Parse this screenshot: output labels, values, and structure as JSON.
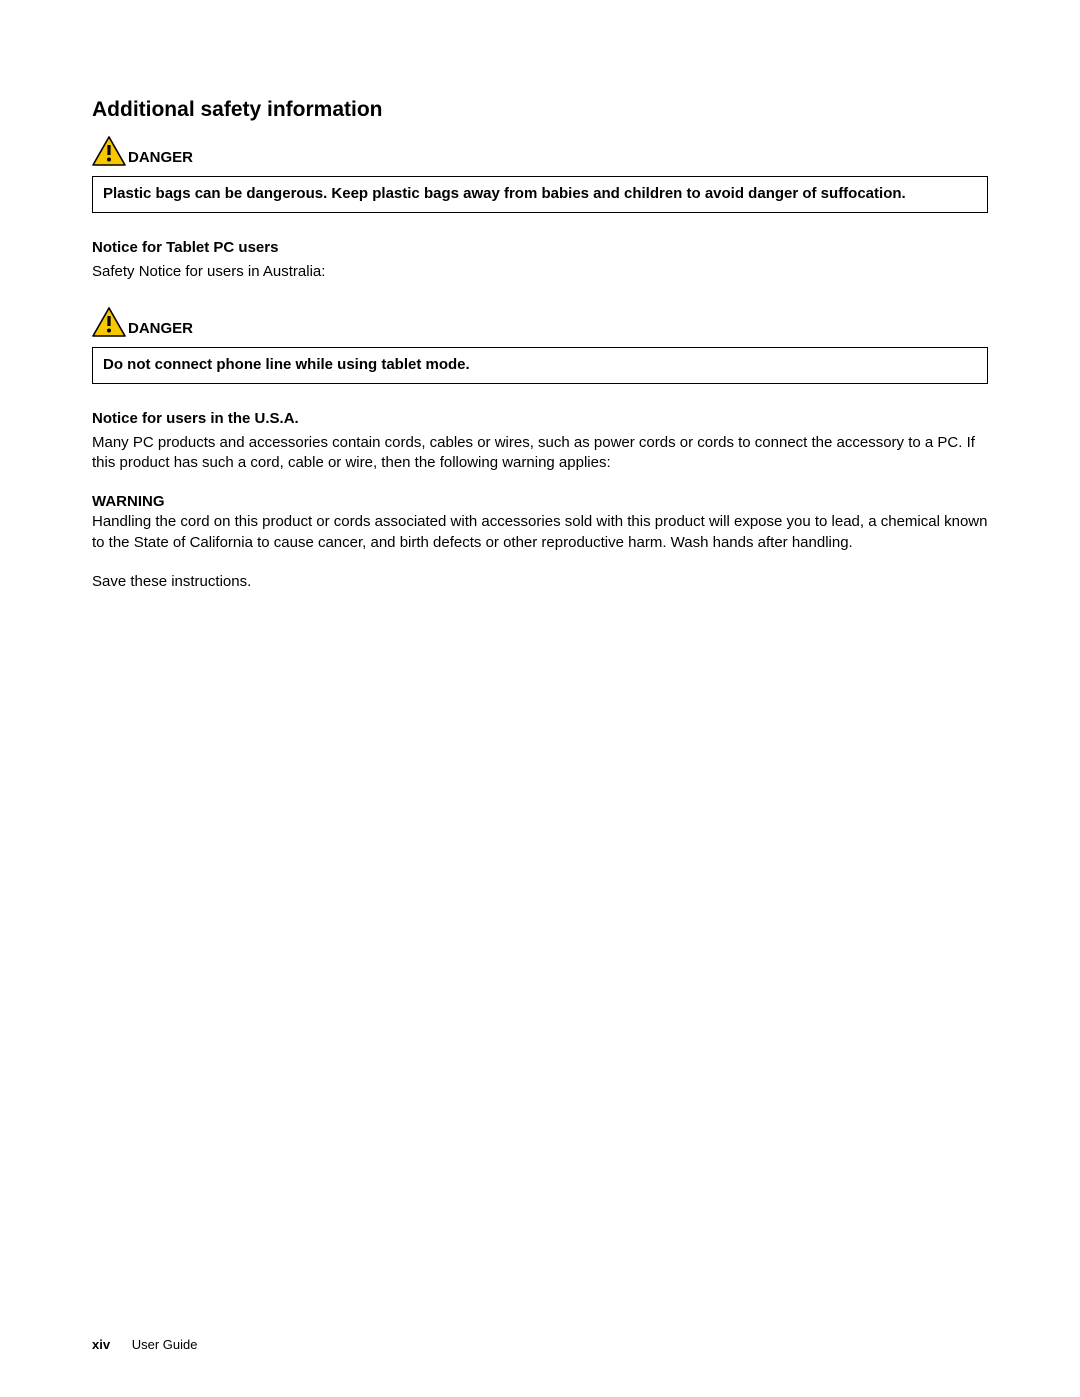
{
  "section_title": "Additional safety information",
  "danger1": {
    "label": "DANGER",
    "box_text": "Plastic bags can be dangerous. Keep plastic bags away from babies and children to avoid danger of suffocation."
  },
  "tablet": {
    "heading": "Notice for Tablet PC users",
    "body": "Safety Notice for users in Australia:"
  },
  "danger2": {
    "label": "DANGER",
    "box_text": "Do not connect phone line while using tablet mode."
  },
  "usa": {
    "heading": "Notice for users in the U.S.A.",
    "body": "Many PC products and accessories contain cords, cables or wires, such as power cords or cords to connect the accessory to a PC. If this product has such a cord, cable or wire, then the following warning applies:"
  },
  "warning": {
    "heading": "WARNING",
    "body": "Handling the cord on this product or cords associated with accessories sold with this product will expose you to lead, a chemical known to the State of California to cause cancer, and birth defects or other reproductive harm. Wash hands after handling."
  },
  "save_text": "Save these instructions.",
  "footer": {
    "page_num": "xiv",
    "doc_title": "User Guide"
  }
}
